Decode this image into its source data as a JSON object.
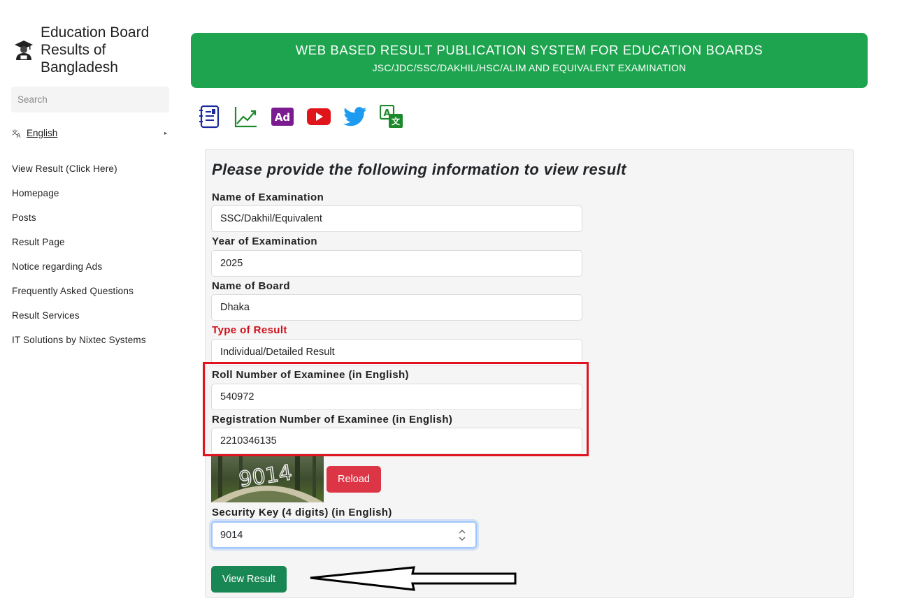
{
  "sidebar": {
    "brand_title": "Education Board Results of Bangladesh",
    "search_placeholder": "Search",
    "language": "English",
    "nav": [
      "View Result (Click Here)",
      "Homepage",
      "Posts",
      "Result Page",
      "Notice regarding Ads",
      "Frequently Asked Questions",
      "Result Services",
      "IT Solutions by Nixtec Systems"
    ]
  },
  "banner": {
    "title": "WEB BASED RESULT PUBLICATION SYSTEM FOR EDUCATION BOARDS",
    "subtitle": "JSC/JDC/SSC/DAKHIL/HSC/ALIM AND EQUIVALENT EXAMINATION"
  },
  "icons": [
    "result-list-icon",
    "trend-chart-icon",
    "ad-icon",
    "youtube-icon",
    "twitter-icon",
    "translate-icon"
  ],
  "form": {
    "heading": "Please provide the following information to view result",
    "exam_label": "Name of Examination",
    "exam_value": "SSC/Dakhil/Equivalent",
    "year_label": "Year of Examination",
    "year_value": "2025",
    "board_label": "Name of Board",
    "board_value": "Dhaka",
    "type_label": "Type of Result",
    "type_value": "Individual/Detailed Result",
    "roll_label": "Roll Number of Examinee (in English)",
    "roll_value": "540972",
    "reg_label": "Registration Number of Examinee (in English)",
    "reg_value": "2210346135",
    "captcha_text": "9014",
    "reload_label": "Reload",
    "key_label": "Security Key (4 digits) (in English)",
    "key_value": "9014",
    "submit_label": "View Result"
  },
  "colors": {
    "banner": "#1ea44f",
    "highlight": "#e0141e",
    "reload": "#dc3545",
    "submit": "#198754",
    "required_label": "#d0101a"
  }
}
